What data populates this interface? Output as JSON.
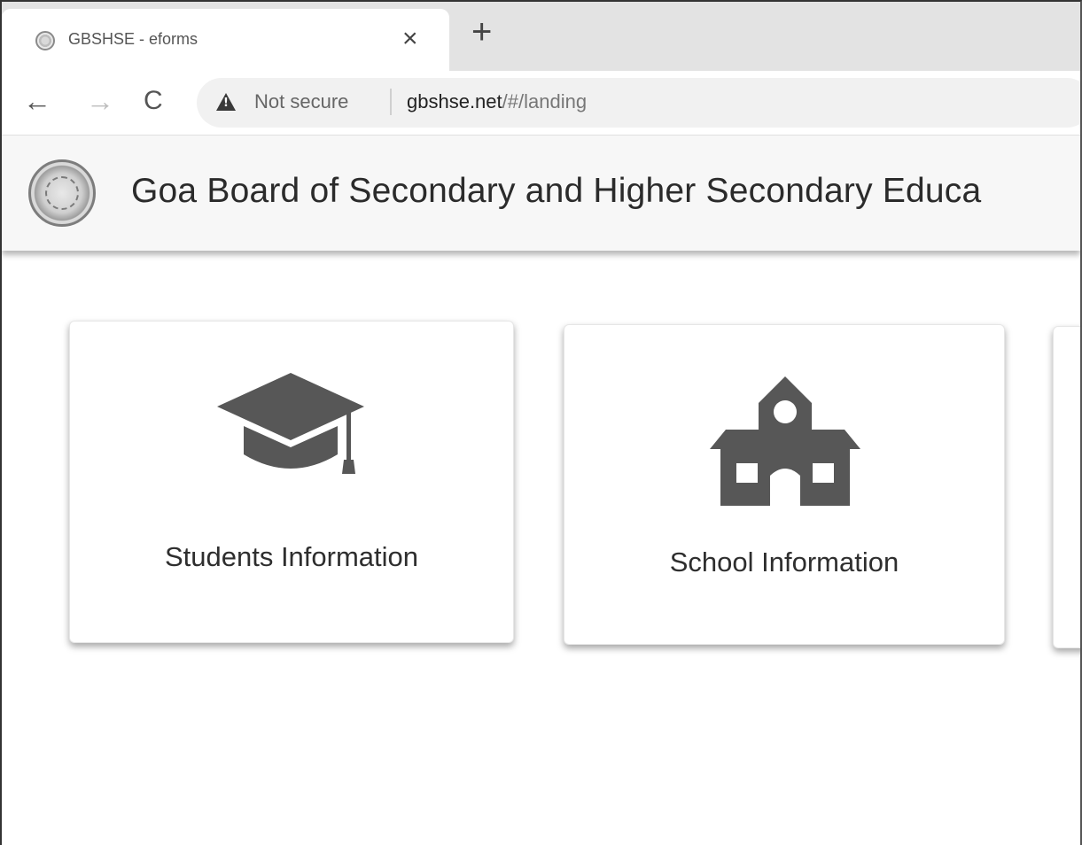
{
  "browser": {
    "tab": {
      "title": "GBSHSE - eforms",
      "close_glyph": "×",
      "favicon": "site-seal-icon"
    },
    "new_tab_glyph": "+",
    "nav": {
      "back_glyph": "←",
      "forward_glyph": "→",
      "reload_glyph": "C"
    },
    "address": {
      "security_label": "Not secure",
      "domain": "gbshse.net",
      "path": "/#/landing"
    }
  },
  "header": {
    "title": "Goa Board of Secondary and Higher Secondary Educa",
    "logo": "board-seal-icon"
  },
  "cards": [
    {
      "label": "Students Information",
      "icon": "graduation-cap-icon"
    },
    {
      "label": "School Information",
      "icon": "school-building-icon"
    }
  ],
  "colors": {
    "icon_gray": "#575757",
    "text_dark": "#2e2e2e",
    "header_bg": "#f7f7f7",
    "tabstrip_bg": "#e3e3e3"
  }
}
